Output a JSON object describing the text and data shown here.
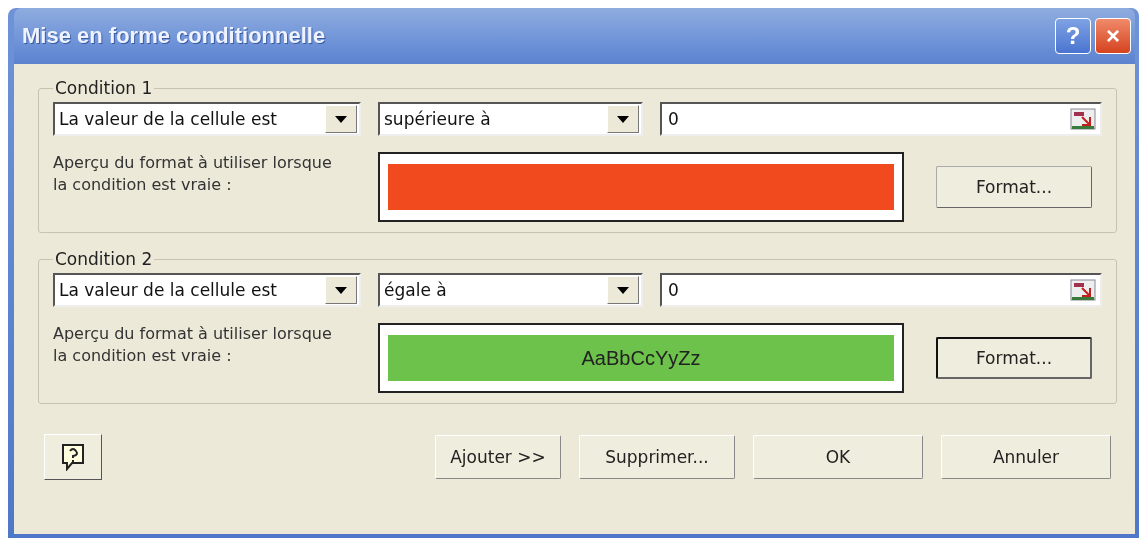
{
  "window": {
    "title": "Mise en forme conditionnelle",
    "title_buttons": [
      "?",
      "×"
    ]
  },
  "conditions": [
    {
      "title": "Condition 1",
      "field": "La valeur de la cellule est",
      "operator": "supérieure à",
      "value": "0",
      "preview_label": "Aperçu du format à utiliser lorsque la condition est vraie :",
      "preview": {
        "color": "#f04a1e"
      },
      "format_button": {
        "label": "Format...",
        "focused": false
      }
    },
    {
      "title": "Condition 2",
      "field": "La valeur de la cellule est",
      "operator": "égale à",
      "value": "0",
      "preview_label": "Aperçu du format à utiliser lorsque la condition est vraie :",
      "preview": {
        "color": "#6cc24a",
        "sample": "AaBbCcYyZz"
      },
      "format_button": {
        "label": "Format...",
        "focused": true
      }
    }
  ],
  "buttons": [
    "Ajouter >>",
    "Supprimer...",
    "OK",
    "Annuler"
  ]
}
